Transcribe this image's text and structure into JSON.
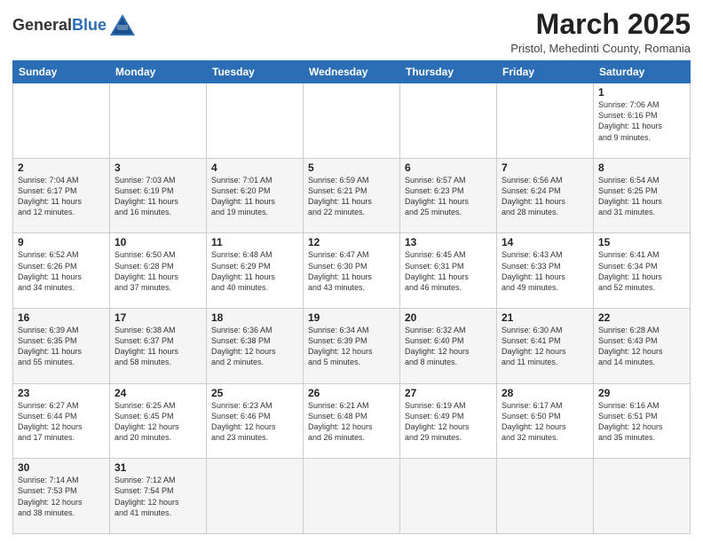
{
  "header": {
    "logo_general": "General",
    "logo_blue": "Blue",
    "month": "March 2025",
    "location": "Pristol, Mehedinti County, Romania"
  },
  "weekdays": [
    "Sunday",
    "Monday",
    "Tuesday",
    "Wednesday",
    "Thursday",
    "Friday",
    "Saturday"
  ],
  "weeks": [
    [
      {
        "day": "",
        "info": ""
      },
      {
        "day": "",
        "info": ""
      },
      {
        "day": "",
        "info": ""
      },
      {
        "day": "",
        "info": ""
      },
      {
        "day": "",
        "info": ""
      },
      {
        "day": "",
        "info": ""
      },
      {
        "day": "1",
        "info": "Sunrise: 7:06 AM\nSunset: 6:16 PM\nDaylight: 11 hours\nand 9 minutes."
      }
    ],
    [
      {
        "day": "2",
        "info": "Sunrise: 7:04 AM\nSunset: 6:17 PM\nDaylight: 11 hours\nand 12 minutes."
      },
      {
        "day": "3",
        "info": "Sunrise: 7:03 AM\nSunset: 6:19 PM\nDaylight: 11 hours\nand 16 minutes."
      },
      {
        "day": "4",
        "info": "Sunrise: 7:01 AM\nSunset: 6:20 PM\nDaylight: 11 hours\nand 19 minutes."
      },
      {
        "day": "5",
        "info": "Sunrise: 6:59 AM\nSunset: 6:21 PM\nDaylight: 11 hours\nand 22 minutes."
      },
      {
        "day": "6",
        "info": "Sunrise: 6:57 AM\nSunset: 6:23 PM\nDaylight: 11 hours\nand 25 minutes."
      },
      {
        "day": "7",
        "info": "Sunrise: 6:56 AM\nSunset: 6:24 PM\nDaylight: 11 hours\nand 28 minutes."
      },
      {
        "day": "8",
        "info": "Sunrise: 6:54 AM\nSunset: 6:25 PM\nDaylight: 11 hours\nand 31 minutes."
      }
    ],
    [
      {
        "day": "9",
        "info": "Sunrise: 6:52 AM\nSunset: 6:26 PM\nDaylight: 11 hours\nand 34 minutes."
      },
      {
        "day": "10",
        "info": "Sunrise: 6:50 AM\nSunset: 6:28 PM\nDaylight: 11 hours\nand 37 minutes."
      },
      {
        "day": "11",
        "info": "Sunrise: 6:48 AM\nSunset: 6:29 PM\nDaylight: 11 hours\nand 40 minutes."
      },
      {
        "day": "12",
        "info": "Sunrise: 6:47 AM\nSunset: 6:30 PM\nDaylight: 11 hours\nand 43 minutes."
      },
      {
        "day": "13",
        "info": "Sunrise: 6:45 AM\nSunset: 6:31 PM\nDaylight: 11 hours\nand 46 minutes."
      },
      {
        "day": "14",
        "info": "Sunrise: 6:43 AM\nSunset: 6:33 PM\nDaylight: 11 hours\nand 49 minutes."
      },
      {
        "day": "15",
        "info": "Sunrise: 6:41 AM\nSunset: 6:34 PM\nDaylight: 11 hours\nand 52 minutes."
      }
    ],
    [
      {
        "day": "16",
        "info": "Sunrise: 6:39 AM\nSunset: 6:35 PM\nDaylight: 11 hours\nand 55 minutes."
      },
      {
        "day": "17",
        "info": "Sunrise: 6:38 AM\nSunset: 6:37 PM\nDaylight: 11 hours\nand 58 minutes."
      },
      {
        "day": "18",
        "info": "Sunrise: 6:36 AM\nSunset: 6:38 PM\nDaylight: 12 hours\nand 2 minutes."
      },
      {
        "day": "19",
        "info": "Sunrise: 6:34 AM\nSunset: 6:39 PM\nDaylight: 12 hours\nand 5 minutes."
      },
      {
        "day": "20",
        "info": "Sunrise: 6:32 AM\nSunset: 6:40 PM\nDaylight: 12 hours\nand 8 minutes."
      },
      {
        "day": "21",
        "info": "Sunrise: 6:30 AM\nSunset: 6:41 PM\nDaylight: 12 hours\nand 11 minutes."
      },
      {
        "day": "22",
        "info": "Sunrise: 6:28 AM\nSunset: 6:43 PM\nDaylight: 12 hours\nand 14 minutes."
      }
    ],
    [
      {
        "day": "23",
        "info": "Sunrise: 6:27 AM\nSunset: 6:44 PM\nDaylight: 12 hours\nand 17 minutes."
      },
      {
        "day": "24",
        "info": "Sunrise: 6:25 AM\nSunset: 6:45 PM\nDaylight: 12 hours\nand 20 minutes."
      },
      {
        "day": "25",
        "info": "Sunrise: 6:23 AM\nSunset: 6:46 PM\nDaylight: 12 hours\nand 23 minutes."
      },
      {
        "day": "26",
        "info": "Sunrise: 6:21 AM\nSunset: 6:48 PM\nDaylight: 12 hours\nand 26 minutes."
      },
      {
        "day": "27",
        "info": "Sunrise: 6:19 AM\nSunset: 6:49 PM\nDaylight: 12 hours\nand 29 minutes."
      },
      {
        "day": "28",
        "info": "Sunrise: 6:17 AM\nSunset: 6:50 PM\nDaylight: 12 hours\nand 32 minutes."
      },
      {
        "day": "29",
        "info": "Sunrise: 6:16 AM\nSunset: 6:51 PM\nDaylight: 12 hours\nand 35 minutes."
      }
    ],
    [
      {
        "day": "30",
        "info": "Sunrise: 7:14 AM\nSunset: 7:53 PM\nDaylight: 12 hours\nand 38 minutes."
      },
      {
        "day": "31",
        "info": "Sunrise: 7:12 AM\nSunset: 7:54 PM\nDaylight: 12 hours\nand 41 minutes."
      },
      {
        "day": "",
        "info": ""
      },
      {
        "day": "",
        "info": ""
      },
      {
        "day": "",
        "info": ""
      },
      {
        "day": "",
        "info": ""
      },
      {
        "day": "",
        "info": ""
      }
    ]
  ]
}
